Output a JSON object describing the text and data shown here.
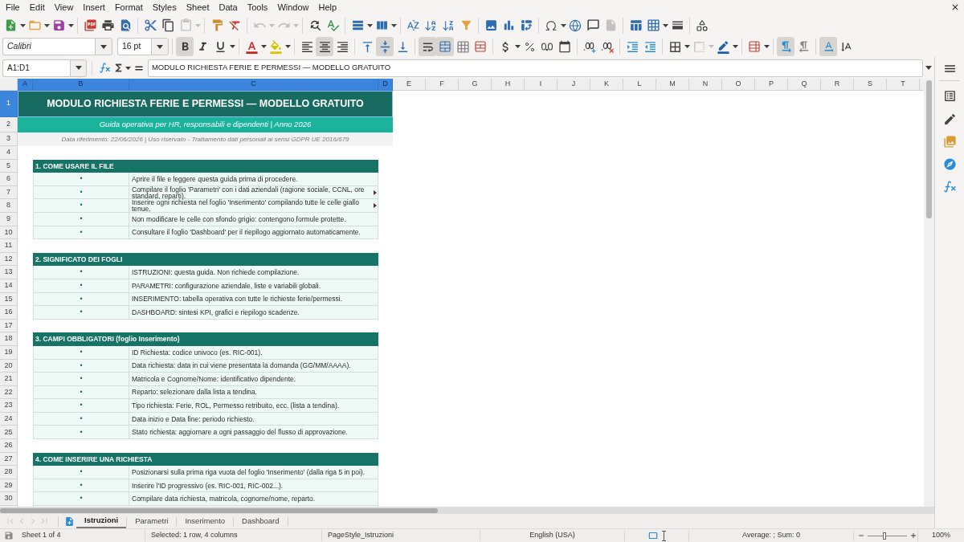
{
  "menu_bar": [
    "File",
    "Edit",
    "View",
    "Insert",
    "Format",
    "Styles",
    "Sheet",
    "Data",
    "Tools",
    "Window",
    "Help"
  ],
  "standard_toolbar": {
    "paste_disabled": true,
    "undo_disabled": true,
    "redo_disabled": true,
    "headers_footers_disabled": true
  },
  "formatting_toolbar": {
    "font_name": "Calibri",
    "font_size": "16 pt",
    "bold": true,
    "italic": false,
    "underline": false,
    "align_left": false,
    "align_center": true,
    "align_right": false,
    "align_top": false,
    "center_vertically": true,
    "align_bottom": false,
    "wrap_text": true,
    "merge_and_center": true,
    "merge_cells": false,
    "unmerge_cells": false,
    "border_style_disabled": true,
    "left_to_right": true,
    "right_to_left": false,
    "text_horizontal": true,
    "text_vertical": false
  },
  "formula_bar": {
    "name_box": "A1:D1",
    "formula": "MODULO RICHIESTA FERIE E PERMESSI — MODELLO GRATUITO"
  },
  "columns": [
    {
      "label": "A",
      "selected": true
    },
    {
      "label": "B",
      "selected": true
    },
    {
      "label": "C",
      "selected": true
    },
    {
      "label": "D",
      "selected": true
    },
    {
      "label": "E",
      "selected": false
    },
    {
      "label": "F",
      "selected": false
    },
    {
      "label": "G",
      "selected": false
    },
    {
      "label": "H",
      "selected": false
    },
    {
      "label": "I",
      "selected": false
    },
    {
      "label": "J",
      "selected": false
    },
    {
      "label": "K",
      "selected": false
    },
    {
      "label": "L",
      "selected": false
    },
    {
      "label": "M",
      "selected": false
    },
    {
      "label": "N",
      "selected": false
    },
    {
      "label": "O",
      "selected": false
    },
    {
      "label": "P",
      "selected": false
    },
    {
      "label": "Q",
      "selected": false
    },
    {
      "label": "R",
      "selected": false
    },
    {
      "label": "S",
      "selected": false
    },
    {
      "label": "T",
      "selected": false
    }
  ],
  "rows": [
    {
      "label": "1",
      "selected": true
    },
    {
      "label": "2",
      "selected": false
    },
    {
      "label": "3",
      "selected": false
    },
    {
      "label": "4",
      "selected": false
    },
    {
      "label": "5",
      "selected": false
    },
    {
      "label": "6",
      "selected": false
    },
    {
      "label": "7",
      "selected": false
    },
    {
      "label": "8",
      "selected": false
    },
    {
      "label": "9",
      "selected": false
    },
    {
      "label": "10",
      "selected": false
    },
    {
      "label": "11",
      "selected": false
    },
    {
      "label": "12",
      "selected": false
    },
    {
      "label": "13",
      "selected": false
    },
    {
      "label": "14",
      "selected": false
    },
    {
      "label": "15",
      "selected": false
    },
    {
      "label": "16",
      "selected": false
    },
    {
      "label": "17",
      "selected": false
    },
    {
      "label": "18",
      "selected": false
    },
    {
      "label": "19",
      "selected": false
    },
    {
      "label": "20",
      "selected": false
    },
    {
      "label": "21",
      "selected": false
    },
    {
      "label": "22",
      "selected": false
    },
    {
      "label": "23",
      "selected": false
    },
    {
      "label": "24",
      "selected": false
    },
    {
      "label": "25",
      "selected": false
    },
    {
      "label": "26",
      "selected": false
    },
    {
      "label": "27",
      "selected": false
    },
    {
      "label": "28",
      "selected": false
    },
    {
      "label": "29",
      "selected": false
    },
    {
      "label": "30",
      "selected": false
    }
  ],
  "sheet": {
    "title": "MODULO RICHIESTA FERIE E PERMESSI — MODELLO GRATUITO",
    "subtitle": "Guida operativa per HR, responsabili e dipendenti | Anno 2026",
    "note": "Data riferimento: 22/06/2026 | Uso riservato - Trattamento dati personali ai sensi GDPR UE 2016/679",
    "sections": [
      {
        "heading": "1. COME USARE IL FILE",
        "items": [
          {
            "bullet": "•",
            "text": "Aprire il file e leggere questa guida prima di procedere.",
            "wrapped": false
          },
          {
            "bullet": "•",
            "text": "Compilare il foglio 'Parametri' con i dati aziendali (ragione sociale, CCNL, ore standard, reparti).",
            "wrapped": true
          },
          {
            "bullet": "•",
            "text": "Inserire ogni richiesta nel foglio 'Inserimento' compilando tutte le celle giallo tenue.",
            "wrapped": true
          },
          {
            "bullet": "•",
            "text": "Non modificare le celle con sfondo grigio: contengono formule protette.",
            "wrapped": false
          },
          {
            "bullet": "•",
            "text": "Consultare il foglio 'Dashboard' per il riepilogo aggiornato automaticamente.",
            "wrapped": false
          }
        ]
      },
      {
        "heading": "2. SIGNIFICATO DEI FOGLI",
        "items": [
          {
            "bullet": "•",
            "text": "ISTRUZIONI: questa guida. Non richiede compilazione.",
            "wrapped": false
          },
          {
            "bullet": "•",
            "text": "PARAMETRI: configurazione aziendale, liste e variabili globali.",
            "wrapped": false
          },
          {
            "bullet": "•",
            "text": "INSERIMENTO: tabella operativa con tutte le richieste ferie/permessi.",
            "wrapped": false
          },
          {
            "bullet": "•",
            "text": "DASHBOARD: sintesi KPI, grafici e riepilogo scadenze.",
            "wrapped": false
          }
        ]
      },
      {
        "heading": "3. CAMPI OBBLIGATORI (foglio Inserimento)",
        "items": [
          {
            "bullet": "•",
            "text": "ID Richiesta: codice univoco (es. RIC-001).",
            "wrapped": false
          },
          {
            "bullet": "•",
            "text": "Data richiesta: data in cui viene presentata la domanda (GG/MM/AAAA).",
            "wrapped": false
          },
          {
            "bullet": "•",
            "text": "Matricola e Cognome/Nome: identificativo dipendente.",
            "wrapped": false
          },
          {
            "bullet": "•",
            "text": "Reparto: selezionare dalla lista a tendina.",
            "wrapped": false
          },
          {
            "bullet": "•",
            "text": "Tipo richiesta: Ferie, ROL, Permesso retribuito, ecc. (lista a tendina).",
            "wrapped": false
          },
          {
            "bullet": "•",
            "text": "Data inizio e Data fine: periodo richiesto.",
            "wrapped": false
          },
          {
            "bullet": "•",
            "text": "Stato richiesta: aggiornare a ogni passaggio del flusso di approvazione.",
            "wrapped": false
          }
        ]
      },
      {
        "heading": "4. COME INSERIRE UNA RICHIESTA",
        "items": [
          {
            "bullet": "•",
            "text": "Posizionarsi sulla prima riga vuota del foglio 'Inserimento' (dalla riga 5 in poi).",
            "wrapped": false
          },
          {
            "bullet": "•",
            "text": "Inserire l'ID progressivo (es. RIC-001, RIC-002...).",
            "wrapped": false
          },
          {
            "bullet": "•",
            "text": "Compilare data richiesta, matricola, cognome/nome, reparto.",
            "wrapped": false
          }
        ]
      }
    ]
  },
  "sheet_tabs": {
    "navigation_disabled": true,
    "tabs": [
      {
        "label": "Istruzioni",
        "selected": true
      },
      {
        "label": "Parametri",
        "selected": false
      },
      {
        "label": "Inserimento",
        "selected": false
      },
      {
        "label": "Dashboard",
        "selected": false
      }
    ]
  },
  "status_bar": {
    "sheet": "Sheet 1 of 4",
    "selection": "Selected: 1 row, 4 columns",
    "page_style": "PageStyle_Istruzioni",
    "language": "English (USA)",
    "summary": "Average: ; Sum: 0",
    "zoom_slider": {
      "level": 0.42
    },
    "zoom": "100%"
  }
}
